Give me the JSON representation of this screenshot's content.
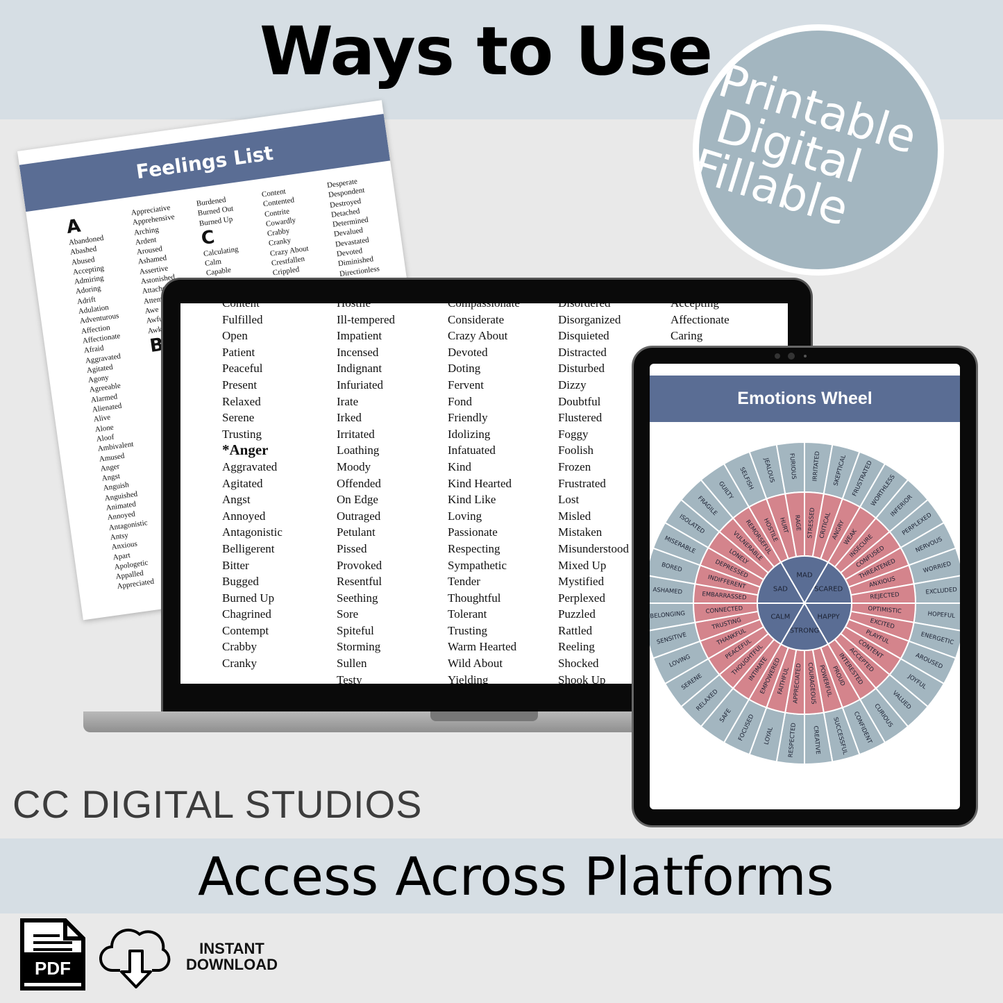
{
  "header": {
    "title": "Ways to Use"
  },
  "badge": {
    "lines": [
      "Printable",
      "Digital",
      "Fillable"
    ]
  },
  "paper": {
    "title": "Feelings List",
    "columns": [
      {
        "heading": "A",
        "items": [
          "Abandoned",
          "Abashed",
          "Abused",
          "Accepting",
          "Admiring",
          "Adoring",
          "Adrift",
          "Adulation",
          "Adventurous",
          "Affection",
          "Affectionate",
          "Afraid",
          "Aggravated",
          "Agitated",
          "Agony",
          "Agreeable",
          "Alarmed",
          "Alienated",
          "Alive",
          "Alone",
          "Aloof",
          "Ambivalent",
          "Amused",
          "Anger",
          "Angst",
          "Anguish",
          "Anguished",
          "Animated",
          "Annoyed",
          "Antagonistic",
          "Antsy",
          "Anxious",
          "Apart",
          "Apologetic",
          "Appalled",
          "Appreciated"
        ]
      },
      {
        "items": [
          "Appreciative",
          "Apprehensive",
          "Arching",
          "Ardent",
          "Aroused",
          "Ashamed",
          "Assertive",
          "Astonished",
          "Attached",
          "Attentive",
          "Awe",
          "Awful",
          "Awkward"
        ],
        "heading2": "B"
      },
      {
        "items": [
          "Burdened",
          "Burned Out",
          "Burned Up"
        ],
        "heading2": "C",
        "items2": [
          "Calculating",
          "Calm",
          "Capable"
        ]
      },
      {
        "items": [
          "Content",
          "Contented",
          "Contrite",
          "Cowardly",
          "Crabby",
          "Cranky",
          "Crazy About",
          "Crestfallen",
          "Crippled"
        ]
      },
      {
        "items": [
          "Desperate",
          "Despondent",
          "Destroyed",
          "Detached",
          "Determined",
          "Devalued",
          "Devastated",
          "Devoted",
          "Diminished",
          "Directionless"
        ]
      }
    ]
  },
  "laptop": {
    "columns": [
      [
        "Content",
        "Fulfilled",
        "Open",
        "Patient",
        "Peaceful",
        "Present",
        "Relaxed",
        "Serene",
        "Trusting",
        "*Anger",
        "Aggravated",
        "Agitated",
        "Angst",
        "Annoyed",
        "Antagonistic",
        "Belligerent",
        "Bitter",
        "Bugged",
        "Burned Up",
        "Chagrined",
        "Contempt",
        "Crabby",
        "Cranky"
      ],
      [
        "Hostile",
        "Ill-tempered",
        "Impatient",
        "Incensed",
        "Indignant",
        "Infuriated",
        "Irate",
        "Irked",
        "Irritated",
        "Loathing",
        "Moody",
        "Offended",
        "On Edge",
        "Outraged",
        "Petulant",
        "Pissed",
        "Provoked",
        "Resentful",
        "Seething",
        "Sore",
        "Spiteful",
        "Storming",
        "Sullen",
        "Testy"
      ],
      [
        "Compassionate",
        "Considerate",
        "Crazy About",
        "Devoted",
        "Doting",
        "Fervent",
        "Fond",
        "Friendly",
        "Idolizing",
        "Infatuated",
        "Kind",
        "Kind Hearted",
        "Kind Like",
        "Loving",
        "Passionate",
        "Respecting",
        "Sympathetic",
        "Tender",
        "Thoughtful",
        "Tolerant",
        "Trusting",
        "Warm Hearted",
        "Wild About",
        "Yielding"
      ],
      [
        "Disordered",
        "Disorganized",
        "Disquieted",
        "Distracted",
        "Disturbed",
        "Dizzy",
        "Doubtful",
        "Flustered",
        "Foggy",
        "Foolish",
        "Frozen",
        "Frustrated",
        "Lost",
        "Misled",
        "Mistaken",
        "Misunderstood",
        "Mixed Up",
        "Mystified",
        "Perplexed",
        "Puzzled",
        "Rattled",
        "Reeling",
        "Shocked",
        "Shook Up"
      ],
      [
        "Accepting",
        "Affectionate",
        "Caring"
      ]
    ]
  },
  "tablet": {
    "title": "Emotions Wheel",
    "wheel": {
      "core": [
        "MAD",
        "SCARED",
        "HAPPY",
        "STRONG",
        "CALM",
        "SAD"
      ],
      "inner": [
        "STRESSED",
        "CRITICAL",
        "ANGRY",
        "WEAK",
        "INSECURE",
        "CONFUSED",
        "THREATENED",
        "ANXIOUS",
        "REJECTED",
        "OPTIMISTIC",
        "EXCITED",
        "PLAYFUL",
        "CONTENT",
        "ACCEPTED",
        "INTERESTED",
        "PROUD",
        "POWERFUL",
        "COURAGEOUS",
        "APPRECIATED",
        "FAITHFUL",
        "EMPOWERED",
        "INTIMATE",
        "THOUGHTFUL",
        "PEACEFUL",
        "THANKFUL",
        "TRUSTING",
        "CONNECTED",
        "EMBARRASSED",
        "INDIFFERENT",
        "DEPRESSED",
        "LONELY",
        "VULNERABLE",
        "REMORSEFUL",
        "HOSTILE",
        "HURT",
        "RAGE"
      ],
      "outer": [
        "IRRITATED",
        "SKEPTICAL",
        "FRUSTRATED",
        "WORTHLESS",
        "INFERIOR",
        "PERPLEXED",
        "NERVOUS",
        "WORRIED",
        "EXCLUDED",
        "HOPEFUL",
        "ENERGETIC",
        "AROUSED",
        "JOYFUL",
        "VALUED",
        "CURIOUS",
        "CONFIDENT",
        "SUCCESSFUL",
        "CREATIVE",
        "RESPECTED",
        "LOYAL",
        "FOCUSED",
        "SAFE",
        "RELAXED",
        "SERENE",
        "LOVING",
        "SENSITIVE",
        "BELONGING",
        "ASHAMED",
        "BORED",
        "MISERABLE",
        "ISOLATED",
        "FRAGILE",
        "GUILTY",
        "SELFISH",
        "JEALOUS",
        "FURIOUS"
      ]
    }
  },
  "brand": "CC DIGITAL STUDIOS",
  "footer": {
    "banner": "Access Across Platforms",
    "pdf_label": "PDF",
    "download_lines": [
      "INSTANT",
      "DOWNLOAD"
    ]
  },
  "icons": {
    "pdf": "pdf-file-icon",
    "download": "cloud-download-icon"
  },
  "colors": {
    "band": "#d6dee4",
    "badge": "#a3b6c0",
    "header": "#5a6d94",
    "wheel_outer": "#a3b6c0",
    "wheel_inner": "#d4848c",
    "wheel_core": "#5a6d94"
  }
}
